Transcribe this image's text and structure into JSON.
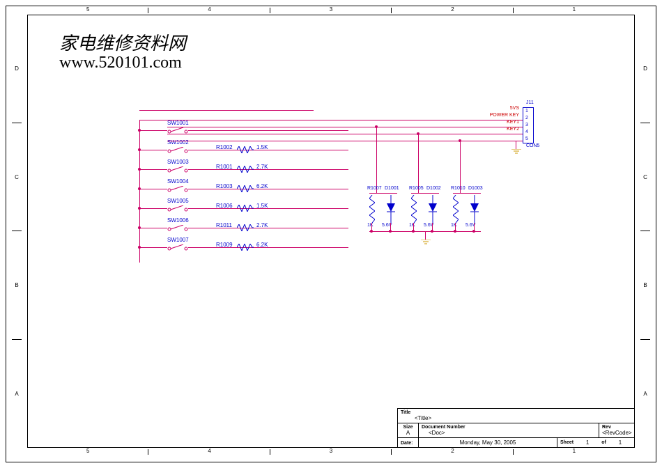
{
  "watermark": {
    "cn": "家电维修资料网",
    "url": "www.520101.com"
  },
  "ruler": {
    "cols": [
      "5",
      "4",
      "3",
      "2",
      "1"
    ],
    "rows": [
      "D",
      "C",
      "B",
      "A"
    ]
  },
  "switches": [
    {
      "ref": "SW1001"
    },
    {
      "ref": "SW1002"
    },
    {
      "ref": "SW1003"
    },
    {
      "ref": "SW1004"
    },
    {
      "ref": "SW1005"
    },
    {
      "ref": "SW1006"
    },
    {
      "ref": "SW1007"
    }
  ],
  "resistors_left": [
    {
      "ref": "R1002",
      "val": "1.5K"
    },
    {
      "ref": "R1001",
      "val": "2.7K"
    },
    {
      "ref": "R1003",
      "val": "6.2K"
    },
    {
      "ref": "R1006",
      "val": "1.5K"
    },
    {
      "ref": "R1011",
      "val": "2.7K"
    },
    {
      "ref": "R1009",
      "val": "6.2K"
    }
  ],
  "pull_resistors": [
    {
      "ref": "R1007",
      "val": "1K"
    },
    {
      "ref": "R1005",
      "val": "1K"
    },
    {
      "ref": "R1010",
      "val": "1K"
    }
  ],
  "diodes": [
    {
      "ref": "D1001",
      "val": "5.6V"
    },
    {
      "ref": "D1002",
      "val": "5.6V"
    },
    {
      "ref": "D1003",
      "val": "5.6V"
    }
  ],
  "connector": {
    "ref": "J11",
    "type": "CON5",
    "nets": [
      "5VS",
      "POWER KEY",
      "KEY1",
      "KEY2",
      ""
    ],
    "pins": [
      "1",
      "2",
      "3",
      "4",
      "5"
    ]
  },
  "title_block": {
    "title_label": "Title",
    "title": "<Title>",
    "size_label": "Size",
    "size": "A",
    "docnum_label": "Document Number",
    "docnum": "<Doc>",
    "rev_label": "Rev",
    "rev": "<RevCode>",
    "date_label": "Date:",
    "date": "Monday, May 30, 2005",
    "sheet_label": "Sheet",
    "sheet": "1",
    "of_label": "of",
    "of": "1"
  }
}
